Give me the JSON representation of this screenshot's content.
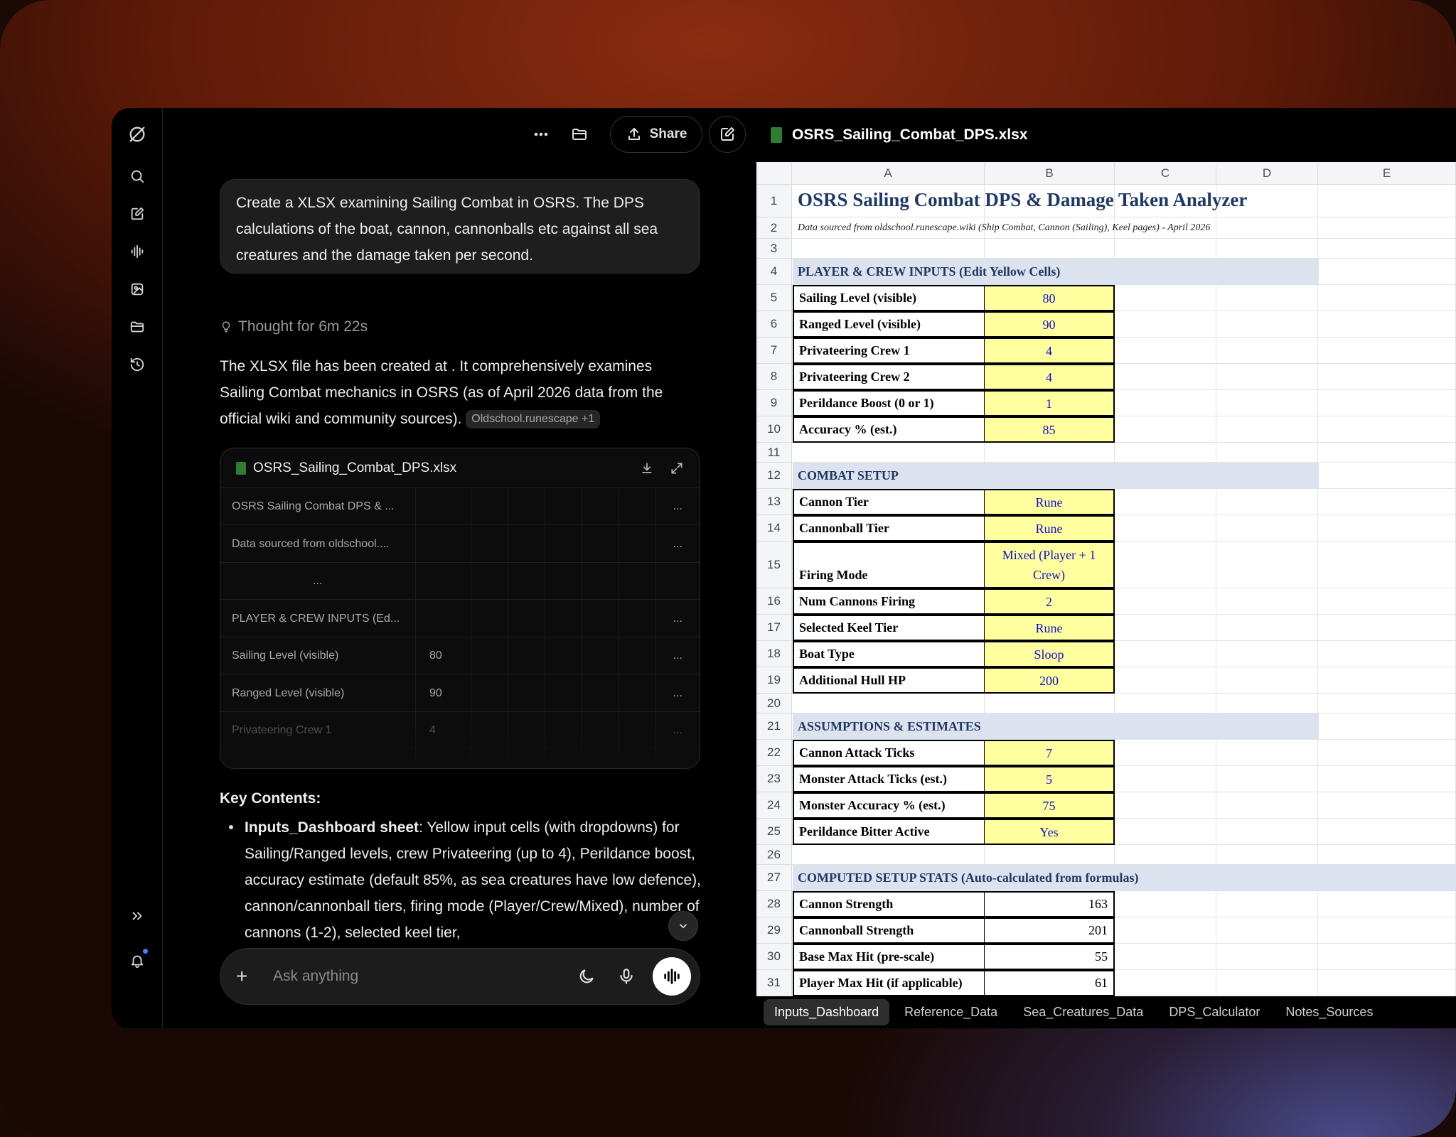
{
  "rail": {
    "logo": "logo-icon"
  },
  "topbar": {
    "share_label": "Share"
  },
  "chat": {
    "user_message": "Create a XLSX examining Sailing Combat in OSRS. The DPS calculations of the boat, cannon, cannonballs etc against all sea creatures and the damage taken per second.",
    "thought": "Thought for 6m 22s",
    "response": "The XLSX file has been created at . It comprehensively examines Sailing Combat mechanics in OSRS (as of April 2026 data from the official wiki and community sources).",
    "source_pill": "Oldschool.runescape +1",
    "key_heading": "Key Contents:",
    "bullet_bold": "Inputs_Dashboard sheet",
    "bullet_text": ": Yellow input cells (with dropdowns) for Sailing/Ranged levels, crew Privateering (up to 4), Perildance boost, accuracy estimate (default 85%, as sea creatures have low defence), cannon/cannonball tiers, firing mode (Player/Crew/Mixed), number of cannons (1-2), selected keel tier,",
    "composer_placeholder": "Ask anything"
  },
  "preview": {
    "filename": "OSRS_Sailing_Combat_DPS.xlsx",
    "ellipsis": "...",
    "rows": [
      {
        "a": "OSRS Sailing Combat DPS & ...",
        "b": ""
      },
      {
        "a": "Data sourced from oldschool....",
        "b": ""
      },
      {
        "a": "",
        "b": ""
      },
      {
        "a": "PLAYER & CREW INPUTS (Ed...",
        "b": ""
      },
      {
        "a": "Sailing Level (visible)",
        "b": "80"
      },
      {
        "a": "Ranged Level (visible)",
        "b": "90"
      },
      {
        "a": "Privateering Crew 1",
        "b": "4"
      }
    ]
  },
  "sheet": {
    "filename": "OSRS_Sailing_Combat_DPS.xlsx",
    "columns": [
      "A",
      "B",
      "C",
      "D",
      "E"
    ],
    "title": "OSRS Sailing Combat DPS & Damage Taken Analyzer",
    "subtitle": "Data sourced from oldschool.runescape.wiki (Ship Combat, Cannon (Sailing), Keel pages) - April 2026",
    "sect1": "PLAYER & CREW INPUTS (Edit Yellow Cells)",
    "sect2": "COMBAT SETUP",
    "sect3": "ASSUMPTIONS & ESTIMATES",
    "sect4": "COMPUTED SETUP STATS (Auto-calculated from formulas)",
    "inputs1": [
      {
        "n": "5",
        "label": "Sailing Level (visible)",
        "value": "80"
      },
      {
        "n": "6",
        "label": "Ranged Level (visible)",
        "value": "90"
      },
      {
        "n": "7",
        "label": "Privateering Crew 1",
        "value": "4"
      },
      {
        "n": "8",
        "label": "Privateering Crew 2",
        "value": "4"
      },
      {
        "n": "9",
        "label": "Perildance Boost (0 or 1)",
        "value": "1"
      },
      {
        "n": "10",
        "label": "Accuracy % (est.)",
        "value": "85"
      }
    ],
    "inputs2": [
      {
        "n": "13",
        "label": "Cannon Tier",
        "value": "Rune"
      },
      {
        "n": "14",
        "label": "Cannonball Tier",
        "value": "Rune"
      },
      {
        "n": "15",
        "label": "Firing Mode",
        "value": "Mixed (Player + 1 Crew)"
      },
      {
        "n": "16",
        "label": "Num Cannons Firing",
        "value": "2"
      },
      {
        "n": "17",
        "label": "Selected Keel Tier",
        "value": "Rune"
      },
      {
        "n": "18",
        "label": "Boat Type",
        "value": "Sloop"
      },
      {
        "n": "19",
        "label": "Additional Hull HP",
        "value": "200"
      }
    ],
    "inputs3": [
      {
        "n": "22",
        "label": "Cannon Attack Ticks",
        "value": "7"
      },
      {
        "n": "23",
        "label": "Monster Attack Ticks (est.)",
        "value": "5"
      },
      {
        "n": "24",
        "label": "Monster Accuracy % (est.)",
        "value": "75"
      },
      {
        "n": "25",
        "label": "Perildance Bitter Active",
        "value": "Yes"
      }
    ],
    "computed": [
      {
        "n": "28",
        "label": "Cannon Strength",
        "value": "163"
      },
      {
        "n": "29",
        "label": "Cannonball Strength",
        "value": "201"
      },
      {
        "n": "30",
        "label": "Base Max Hit (pre-scale)",
        "value": "55"
      },
      {
        "n": "31",
        "label": "Player Max Hit (if applicable)",
        "value": "61"
      }
    ],
    "tabs": [
      "Inputs_Dashboard",
      "Reference_Data",
      "Sea_Creatures_Data",
      "DPS_Calculator",
      "Notes_Sources"
    ]
  }
}
